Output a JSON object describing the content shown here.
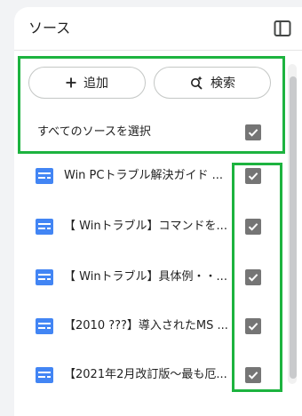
{
  "header": {
    "title": "ソース",
    "toggle_icon": "sidebar-panel-icon"
  },
  "actions": {
    "add_label": "追加",
    "add_icon": "plus-icon",
    "search_label": "検索",
    "search_icon": "sparkle-search-icon"
  },
  "select_all": {
    "label": "すべてのソースを選択",
    "checked": true
  },
  "sources": [
    {
      "title": "Win PCトラブル解決ガイド ...",
      "icon": "document-icon",
      "checked": true
    },
    {
      "title": "【 Winトラブル】コマンドを...",
      "icon": "document-icon",
      "checked": true
    },
    {
      "title": "【 Winトラブル】具体例・・...",
      "icon": "document-icon",
      "checked": true
    },
    {
      "title": "【2010 ???】導入されたMS ...",
      "icon": "document-icon",
      "checked": true
    },
    {
      "title": "【2021年2月改訂版〜最も厄...",
      "icon": "document-icon",
      "checked": true
    }
  ],
  "colors": {
    "highlight": "#1db33f",
    "checkbox": "#757575",
    "doc_icon": "#4285f4"
  }
}
